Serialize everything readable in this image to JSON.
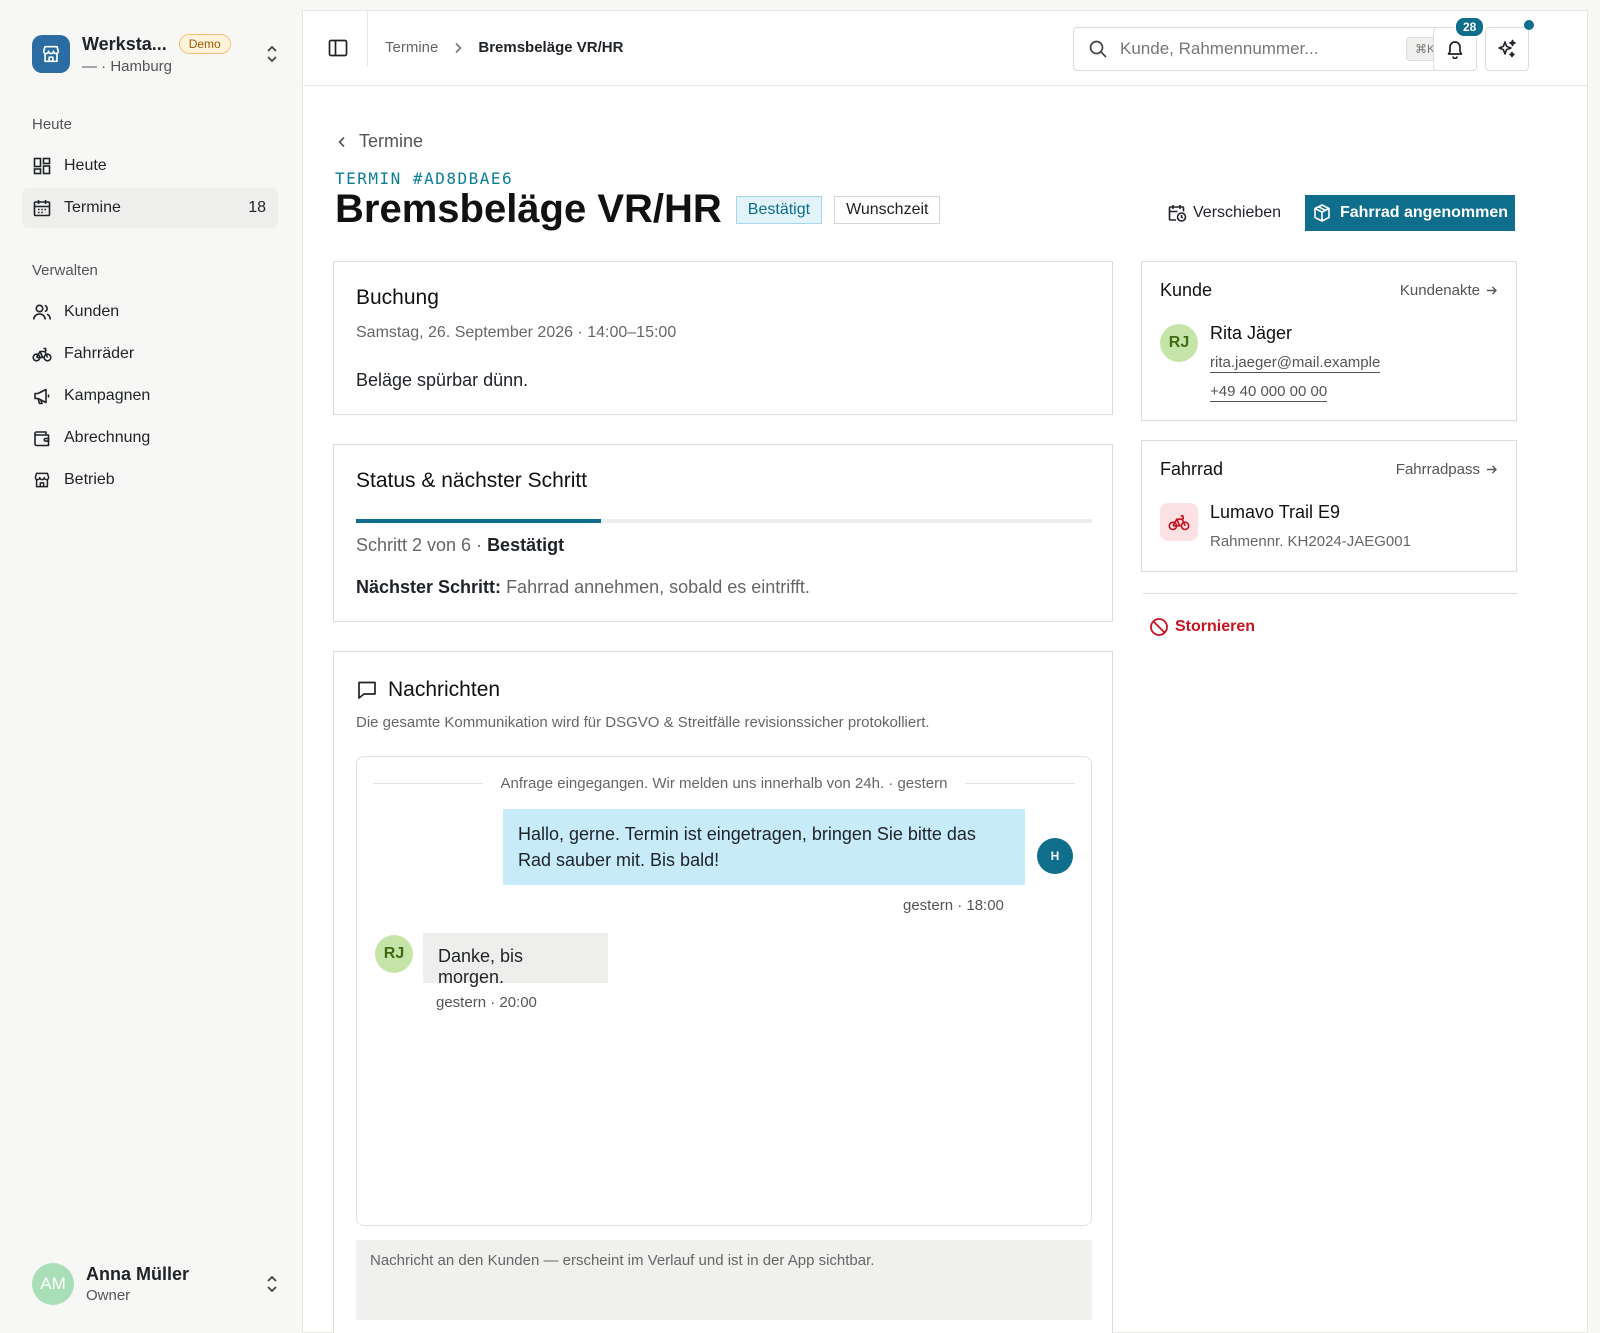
{
  "workspace": {
    "name": "Werksta...",
    "badge": "Demo",
    "location": "— · Hamburg"
  },
  "nav": {
    "section_today": "Heute",
    "item_today": "Heute",
    "item_termine": "Termine",
    "termine_count": "18",
    "section_manage": "Verwalten",
    "items": [
      "Kunden",
      "Fahrräder",
      "Kampagnen",
      "Abrechnung",
      "Betrieb"
    ]
  },
  "user": {
    "initials": "AM",
    "name": "Anna Müller",
    "role": "Owner"
  },
  "topbar": {
    "breadcrumb_parent": "Termine",
    "breadcrumb_current": "Bremsbeläge VR/HR",
    "search_placeholder": "Kunde, Rahmennummer...",
    "search_shortcut": "⌘K",
    "notification_count": "28"
  },
  "header": {
    "back_label": "Termine",
    "termin_id": "TERMIN #AD8DBAE6",
    "title": "Bremsbeläge VR/HR",
    "status_badge": "Bestätigt",
    "time_badge": "Wunschzeit",
    "reschedule_label": "Verschieben",
    "accept_label": "Fahrrad angenommen"
  },
  "booking": {
    "title": "Buchung",
    "date": "Samstag, 26. September 2026 · 14:00–15:00",
    "note": "Beläge spürbar dünn."
  },
  "status": {
    "title": "Status & nächster Schritt",
    "progress": 0.333,
    "step_text": "Schritt 2 von 6 · ",
    "step_label": "Bestätigt",
    "next_label": "Nächster Schritt:",
    "next_text": "Fahrrad annehmen, sobald es eintrifft."
  },
  "messages": {
    "title": "Nachrichten",
    "subtitle": "Die gesamte Kommunikation wird für DSGVO & Streitfälle revisionssicher protokolliert.",
    "system_line": "Anfrage eingegangen. Wir melden uns innerhalb von 24h. · gestern",
    "outgoing_text": "Hallo, gerne. Termin ist eingetragen, bringen Sie bitte das Rad sauber mit. Bis bald!",
    "outgoing_avatar": "H",
    "outgoing_time": "gestern · 18:00",
    "incoming_avatar": "RJ",
    "incoming_text": "Danke, bis morgen.",
    "incoming_time": "gestern · 20:00",
    "composer_placeholder": "Nachricht an den Kunden — erscheint im Verlauf und ist in der App sichtbar."
  },
  "customer": {
    "title": "Kunde",
    "link": "Kundenakte",
    "initials": "RJ",
    "name": "Rita Jäger",
    "email": "rita.jaeger@mail.example",
    "phone": "+49 40 000 00 00"
  },
  "bike": {
    "title": "Fahrrad",
    "link": "Fahrradpass",
    "name": "Lumavo Trail E9",
    "frame": "Rahmennr. KH2024-JAEG001"
  },
  "cancel_label": "Stornieren",
  "colors": {
    "accent": "#0e6e8c",
    "danger": "#c8141f",
    "status_bg": "#e3f3fa",
    "bubble_out": "#c8ebfa"
  }
}
